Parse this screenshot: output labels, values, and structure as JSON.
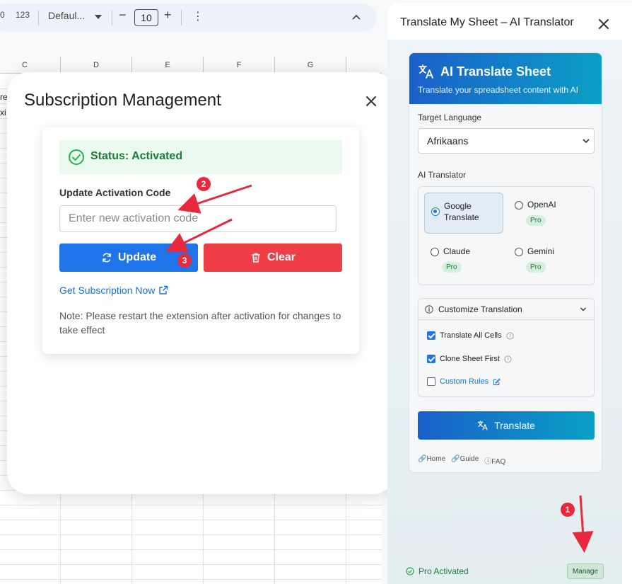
{
  "toolbar": {
    "format_partial": "0",
    "format_123": "123",
    "font": "Defaul...",
    "minus": "−",
    "font_size": "10",
    "plus": "+",
    "more": "⋮"
  },
  "grid": {
    "columns": [
      "C",
      "D",
      "E",
      "F",
      "G"
    ],
    "cell_fragments": [
      "re",
      "xi"
    ]
  },
  "modal": {
    "title": "Subscription Management",
    "status": "Status: Activated",
    "field_label": "Update Activation Code",
    "placeholder": "Enter new activation code",
    "update_label": "Update",
    "clear_label": "Clear",
    "subscription_link": "Get Subscription Now",
    "note": "Note: Please restart the extension after activation for changes to take effect"
  },
  "sidebar": {
    "title": "Translate My Sheet – AI Translator",
    "header_title": "AI Translate Sheet",
    "header_subtitle": "Translate your spreadsheet content with AI",
    "target_language_label": "Target Language",
    "target_language_value": "Afrikaans",
    "ai_translator_label": "AI Translator",
    "engines": [
      {
        "label": "Google Translate",
        "selected": true,
        "pro": ""
      },
      {
        "label": "OpenAI",
        "selected": false,
        "pro": "Pro"
      },
      {
        "label": "Claude",
        "selected": false,
        "pro": "Pro"
      },
      {
        "label": "Gemini",
        "selected": false,
        "pro": "Pro"
      }
    ],
    "customize_label": "Customize Translation",
    "options": [
      {
        "label": "Translate All Cells",
        "checked": true
      },
      {
        "label": "Clone Sheet First",
        "checked": true
      },
      {
        "label": "Custom Rules",
        "checked": false
      }
    ],
    "translate_button": "Translate",
    "links": [
      "Home",
      "Guide",
      "FAQ"
    ],
    "pro_status": "Pro Activated",
    "manage_button": "Manage"
  },
  "annotations": {
    "badge_1": "1",
    "badge_2": "2",
    "badge_3": "3",
    "color": "#e8283c"
  },
  "colors": {
    "update_button": "#1e74e8",
    "clear_button": "#f03e48",
    "status_green": "#1e7b3a"
  }
}
